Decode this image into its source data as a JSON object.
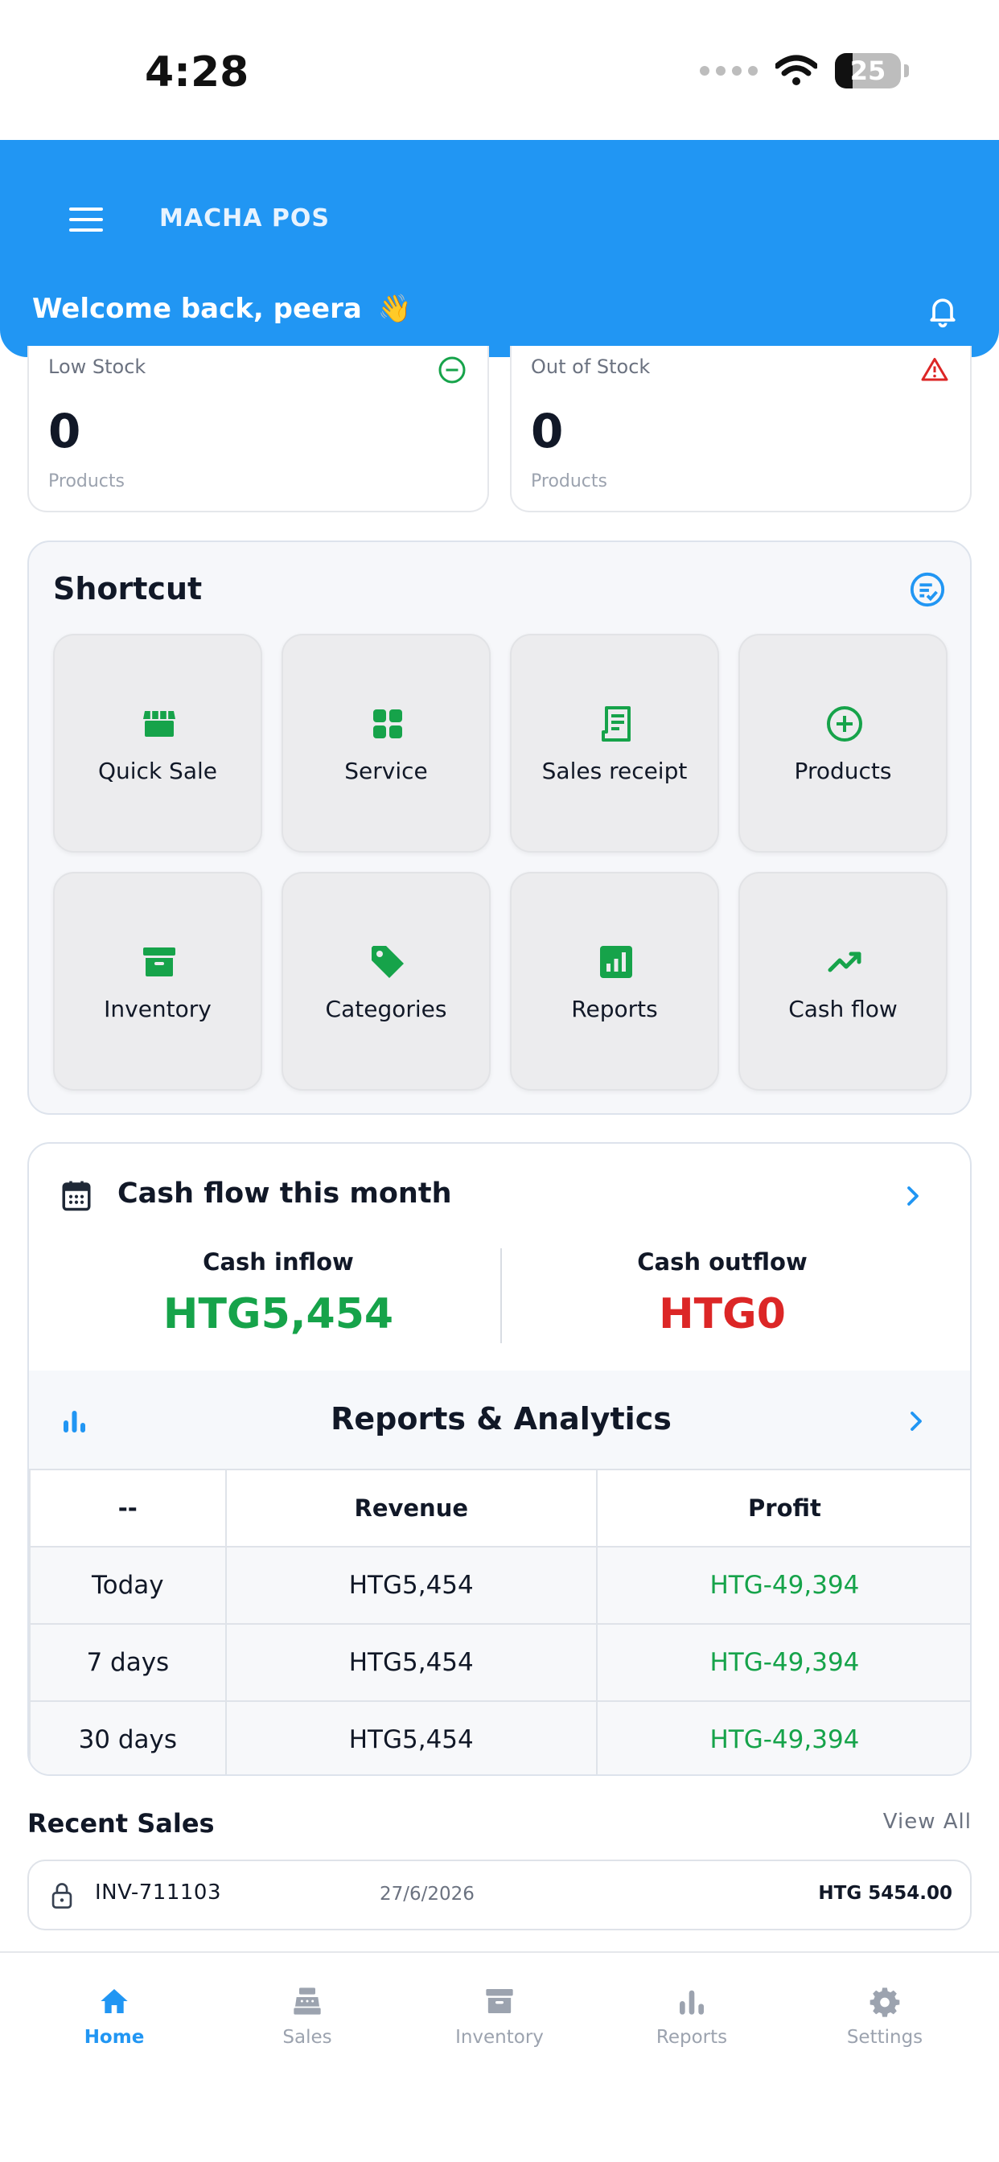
{
  "status_bar": {
    "time": "4:28",
    "battery": "25"
  },
  "header": {
    "app_title": "MACHA POS",
    "welcome": "Welcome back, peera",
    "welcome_emoji": "👋"
  },
  "stock": {
    "low": {
      "label": "Low Stock",
      "value": "0",
      "unit": "Products"
    },
    "out": {
      "label": "Out of Stock",
      "value": "0",
      "unit": "Products"
    }
  },
  "shortcut": {
    "title": "Shortcut",
    "items": [
      {
        "label": "Quick Sale",
        "icon": "store-icon"
      },
      {
        "label": "Service",
        "icon": "grid-icon"
      },
      {
        "label": "Sales receipt",
        "icon": "receipt-icon"
      },
      {
        "label": "Products",
        "icon": "plus-circle-icon"
      },
      {
        "label": "Inventory",
        "icon": "archive-icon"
      },
      {
        "label": "Categories",
        "icon": "tag-icon"
      },
      {
        "label": "Reports",
        "icon": "chart-box-icon"
      },
      {
        "label": "Cash flow",
        "icon": "trend-icon"
      }
    ]
  },
  "cash_flow": {
    "title": "Cash flow this month",
    "inflow_label": "Cash inflow",
    "inflow_value": "HTG5,454",
    "outflow_label": "Cash outflow",
    "outflow_value": "HTG0"
  },
  "reports": {
    "title": "Reports & Analytics",
    "headers": [
      "--",
      "Revenue",
      "Profit"
    ],
    "rows": [
      {
        "period": "Today",
        "revenue": "HTG5,454",
        "profit": "HTG-49,394"
      },
      {
        "period": "7 days",
        "revenue": "HTG5,454",
        "profit": "HTG-49,394"
      },
      {
        "period": "30 days",
        "revenue": "HTG5,454",
        "profit": "HTG-49,394"
      }
    ]
  },
  "recent_sales": {
    "title": "Recent Sales",
    "view_all": "View All",
    "items": [
      {
        "invoice": "INV-711103",
        "date": "27/6/2026",
        "amount": "HTG 5454.00"
      }
    ]
  },
  "nav": {
    "items": [
      {
        "label": "Home",
        "icon": "home-icon",
        "active": true
      },
      {
        "label": "Sales",
        "icon": "register-icon",
        "active": false
      },
      {
        "label": "Inventory",
        "icon": "archive-icon",
        "active": false
      },
      {
        "label": "Reports",
        "icon": "bars-icon",
        "active": false
      },
      {
        "label": "Settings",
        "icon": "gear-icon",
        "active": false
      }
    ]
  },
  "colors": {
    "primary": "#2196f3",
    "success": "#16a34a",
    "danger": "#dc2626"
  }
}
